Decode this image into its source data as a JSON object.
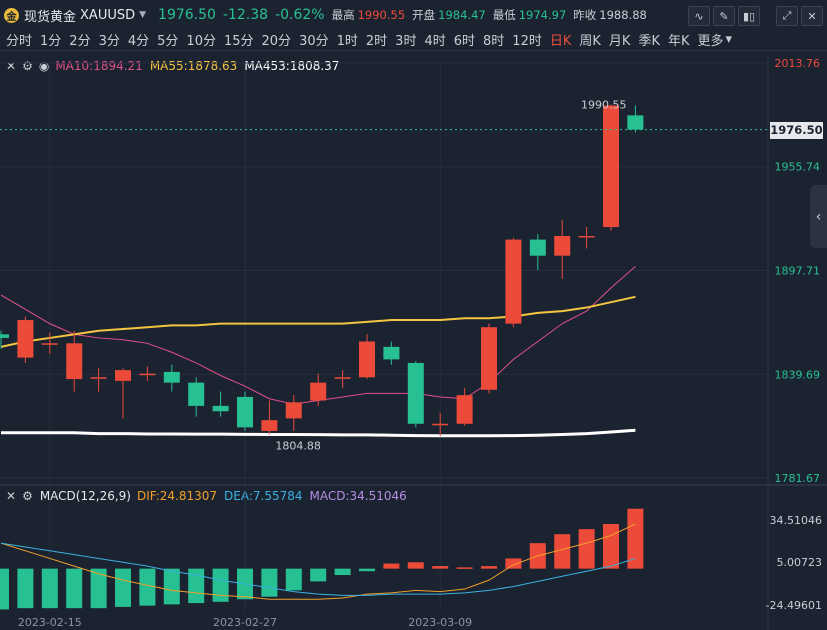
{
  "header": {
    "name": "现货黄金",
    "symbol": "XAUUSD",
    "last": "1976.50",
    "change": "-12.38",
    "change_pct": "-0.62%",
    "high_label": "最高",
    "high": "1990.55",
    "open_label": "开盘",
    "open": "1984.47",
    "low_label": "最低",
    "low": "1974.97",
    "prev_label": "昨收",
    "prev": "1988.88"
  },
  "periods": [
    "分时",
    "1分",
    "2分",
    "3分",
    "4分",
    "5分",
    "10分",
    "15分",
    "20分",
    "30分",
    "1时",
    "2时",
    "3时",
    "4时",
    "6时",
    "8时",
    "12时",
    "日K",
    "周K",
    "月K",
    "季K",
    "年K",
    "更多"
  ],
  "active_period": "日K",
  "ma_legend": {
    "ma10": "MA10:1894.21",
    "ma55": "MA55:1878.63",
    "ma453": "MA453:1808.37"
  },
  "macd_legend": {
    "title": "MACD(12,26,9)",
    "dif": "DIF:24.81307",
    "dea": "DEA:7.55784",
    "macd": "MACD:34.51046"
  },
  "colors": {
    "up": "#ec4b3a",
    "down": "#27c093",
    "ma10": "#e0508a",
    "ma55": "#f5c542",
    "ma453": "#ffffff",
    "dif": "#f0a02a",
    "dea": "#3ab0e0",
    "macd_text": "#b48ce0"
  },
  "chart_data": [
    {
      "type": "candlestick",
      "y_ticks": [
        "2013.76",
        "1955.74",
        "1897.71",
        "1839.69",
        "1781.67"
      ],
      "ylim": [
        1781.67,
        2013.76
      ],
      "x_ticks": [
        "2023-02-15",
        "2023-02-27",
        "2023-03-09"
      ],
      "last_price_label": "1976.50",
      "annotations": {
        "max_label": "1990.55",
        "min_label": "1804.88"
      },
      "candles": [
        {
          "o": 1862,
          "c": 1860,
          "h": 1864,
          "l": 1854
        },
        {
          "o": 1849,
          "c": 1870,
          "h": 1872,
          "l": 1846
        },
        {
          "o": 1857,
          "c": 1857,
          "h": 1863,
          "l": 1851
        },
        {
          "o": 1837,
          "c": 1857,
          "h": 1864,
          "l": 1830
        },
        {
          "o": 1838,
          "c": 1838,
          "h": 1843,
          "l": 1830
        },
        {
          "o": 1836,
          "c": 1842,
          "h": 1843,
          "l": 1815
        },
        {
          "o": 1840,
          "c": 1840,
          "h": 1844,
          "l": 1836
        },
        {
          "o": 1841,
          "c": 1835,
          "h": 1845,
          "l": 1830
        },
        {
          "o": 1835,
          "c": 1822,
          "h": 1838,
          "l": 1816
        },
        {
          "o": 1822,
          "c": 1819,
          "h": 1830,
          "l": 1816
        },
        {
          "o": 1827,
          "c": 1810,
          "h": 1830,
          "l": 1808
        },
        {
          "o": 1808,
          "c": 1814,
          "h": 1825,
          "l": 1806
        },
        {
          "o": 1815,
          "c": 1824,
          "h": 1828,
          "l": 1808
        },
        {
          "o": 1825,
          "c": 1835,
          "h": 1840,
          "l": 1822
        },
        {
          "o": 1838,
          "c": 1838,
          "h": 1842,
          "l": 1832
        },
        {
          "o": 1838,
          "c": 1858,
          "h": 1862,
          "l": 1837
        },
        {
          "o": 1855,
          "c": 1848,
          "h": 1858,
          "l": 1845
        },
        {
          "o": 1846,
          "c": 1812,
          "h": 1847,
          "l": 1810
        },
        {
          "o": 1812,
          "c": 1812,
          "h": 1818,
          "l": 1805
        },
        {
          "o": 1812,
          "c": 1828,
          "h": 1832,
          "l": 1811
        },
        {
          "o": 1831,
          "c": 1866,
          "h": 1868,
          "l": 1829
        },
        {
          "o": 1868,
          "c": 1915,
          "h": 1916,
          "l": 1866
        },
        {
          "o": 1915,
          "c": 1906,
          "h": 1918,
          "l": 1898
        },
        {
          "o": 1906,
          "c": 1917,
          "h": 1926,
          "l": 1893
        },
        {
          "o": 1917,
          "c": 1917,
          "h": 1922,
          "l": 1910
        },
        {
          "o": 1922,
          "c": 1990,
          "h": 1990.55,
          "l": 1920
        },
        {
          "o": 1984.47,
          "c": 1976.5,
          "h": 1990,
          "l": 1974.97
        }
      ],
      "series": [
        {
          "name": "MA10",
          "values": [
            null,
            null,
            null,
            null,
            null,
            null,
            null,
            null,
            null,
            null,
            null,
            null,
            null,
            null,
            null,
            null,
            null,
            null,
            null,
            null,
            null,
            null,
            null,
            null,
            null,
            null,
            null
          ],
          "points": [
            1884,
            1876,
            1868,
            1862,
            1860,
            1859,
            1857,
            1852,
            1846,
            1839,
            1833,
            1826,
            1823,
            1825,
            1827,
            1829,
            1829,
            1829,
            1827,
            1826,
            1835,
            1848,
            1858,
            1868,
            1875,
            1888,
            1900
          ]
        },
        {
          "name": "MA55",
          "points": [
            1855,
            1858,
            1860,
            1862,
            1864,
            1865,
            1866,
            1867,
            1867,
            1868,
            1868,
            1868,
            1868,
            1868,
            1868,
            1869,
            1870,
            1870,
            1870,
            1871,
            1871,
            1872,
            1874,
            1875,
            1877,
            1880,
            1883
          ]
        },
        {
          "name": "MA453",
          "points": [
            1807,
            1807,
            1807,
            1807,
            1806.5,
            1806.5,
            1806.3,
            1806.3,
            1806.2,
            1806.2,
            1806.1,
            1806,
            1806,
            1805.9,
            1805.8,
            1805.8,
            1805.6,
            1805.4,
            1805.3,
            1805.3,
            1805.3,
            1805.4,
            1805.6,
            1806,
            1806.5,
            1807.4,
            1808.37
          ]
        }
      ]
    },
    {
      "type": "bar",
      "name_ref": "MACD",
      "y_ticks": [
        "34.51046",
        "5.00723",
        "-24.49601"
      ],
      "ylim": [
        -34,
        46
      ],
      "histogram": [
        -32,
        -31,
        -31,
        -31,
        -31,
        -30,
        -29,
        -28,
        -27,
        -26,
        -24,
        -22,
        -17,
        -10,
        -5,
        -2,
        4,
        5,
        2,
        1,
        2,
        8,
        20,
        27,
        31,
        35,
        47
      ],
      "dif": [
        20,
        14,
        8,
        2,
        -4,
        -9,
        -13,
        -17,
        -19,
        -21,
        -22,
        -24,
        -24,
        -24,
        -23,
        -20,
        -19,
        -17,
        -18,
        -16,
        -9,
        3,
        10,
        15,
        20,
        26,
        35
      ],
      "dea": [
        20,
        17,
        14,
        11,
        8,
        5,
        2,
        -2,
        -5,
        -9,
        -12,
        -15,
        -18,
        -20,
        -21,
        -21,
        -20,
        -20,
        -20,
        -19,
        -17,
        -14,
        -10,
        -6,
        -2,
        2,
        8
      ]
    }
  ]
}
